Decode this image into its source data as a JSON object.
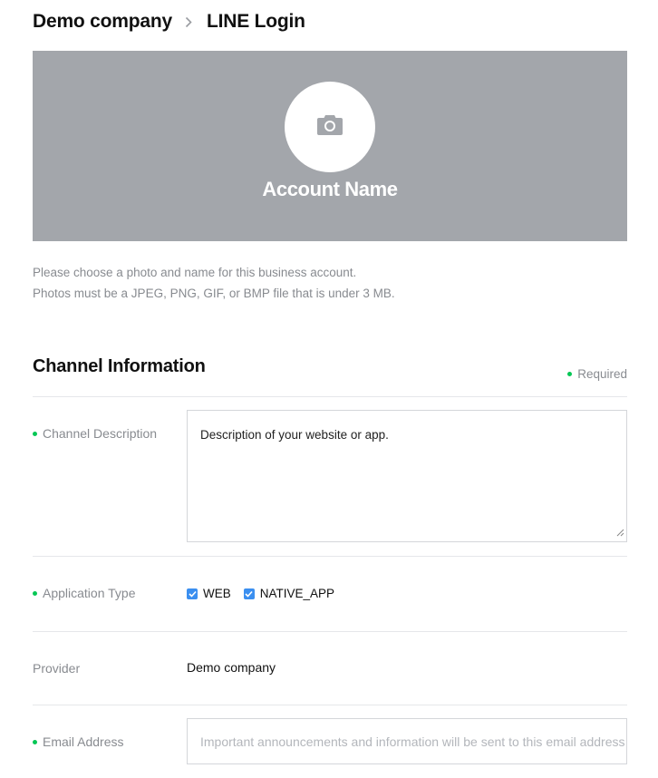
{
  "breadcrumb": {
    "company": "Demo company",
    "current": "LINE Login"
  },
  "cover": {
    "account_name": "Account Name",
    "background_color": "#a3a6ab",
    "photo_icon": "camera-icon"
  },
  "help": {
    "line1": "Please choose a photo and name for this business account.",
    "line2": "Photos must be a JPEG, PNG, GIF, or BMP file that is under 3 MB."
  },
  "channel_info": {
    "title": "Channel Information",
    "required_label": "Required",
    "required_dot_color": "#06c755",
    "description": {
      "label": "Channel Description",
      "value": "Description of your website or app."
    },
    "app_type": {
      "label": "Application Type",
      "options": [
        {
          "label": "WEB",
          "checked": true
        },
        {
          "label": "NATIVE_APP",
          "checked": true
        }
      ],
      "checkbox_color": "#3b8ff0"
    },
    "provider": {
      "label": "Provider",
      "value": "Demo company"
    },
    "email": {
      "label": "Email Address",
      "placeholder": "Important announcements and information will be sent to this email address"
    }
  }
}
